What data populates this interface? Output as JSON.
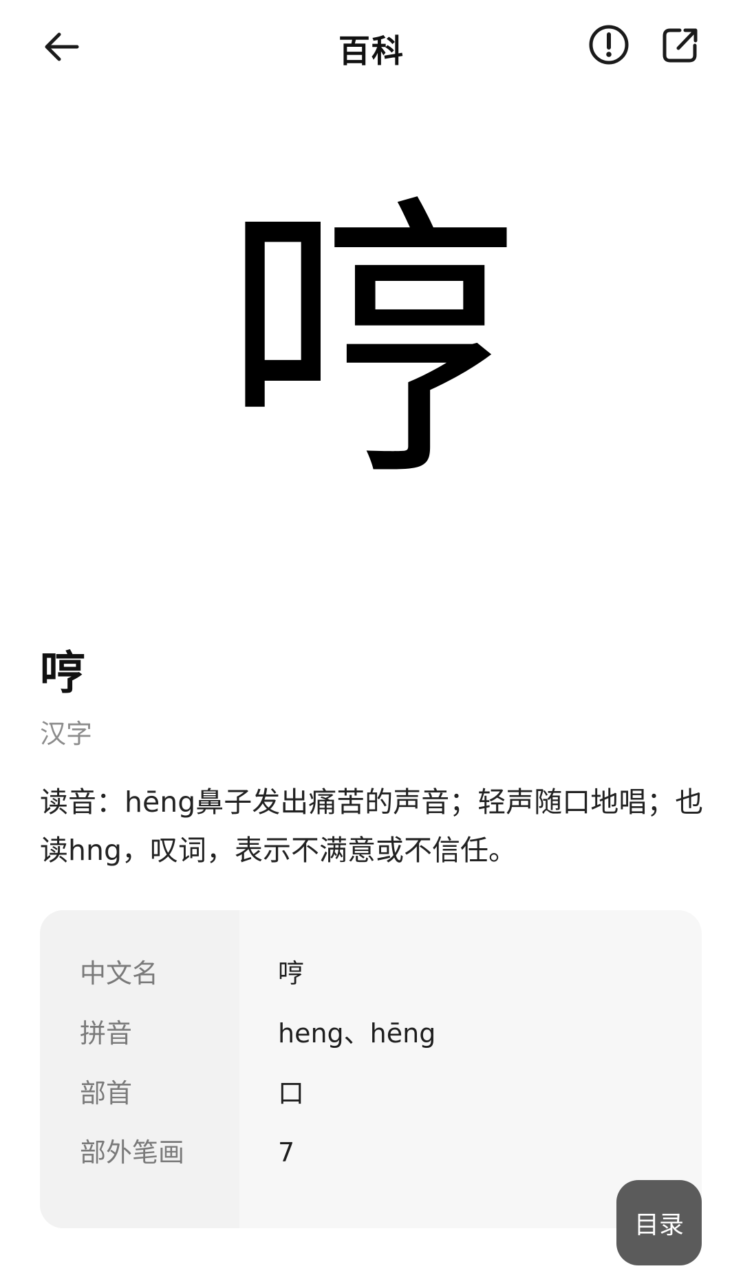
{
  "header": {
    "title": "百科"
  },
  "hero": {
    "character": "哼"
  },
  "entry": {
    "title": "哼",
    "subtitle": "汉字",
    "summary": "读音：hēng鼻子发出痛苦的声音；轻声随口地唱；也读hng，叹词，表示不满意或不信任。"
  },
  "info_card": {
    "rows": [
      {
        "label": "中文名",
        "value": "哼"
      },
      {
        "label": "拼音",
        "value": "heng、hēng"
      },
      {
        "label": "部首",
        "value": "口"
      },
      {
        "label": "部外笔画",
        "value": "7"
      }
    ]
  },
  "toc_button": {
    "label": "目录"
  },
  "icons": {
    "back": "arrow-left-icon",
    "report": "exclamation-circle-icon",
    "share": "share-external-icon"
  },
  "colors": {
    "text_primary": "#111111",
    "text_secondary": "#8c8c8c",
    "card_background": "#f7f7f7",
    "toc_button_background": "#5b5b5b"
  }
}
